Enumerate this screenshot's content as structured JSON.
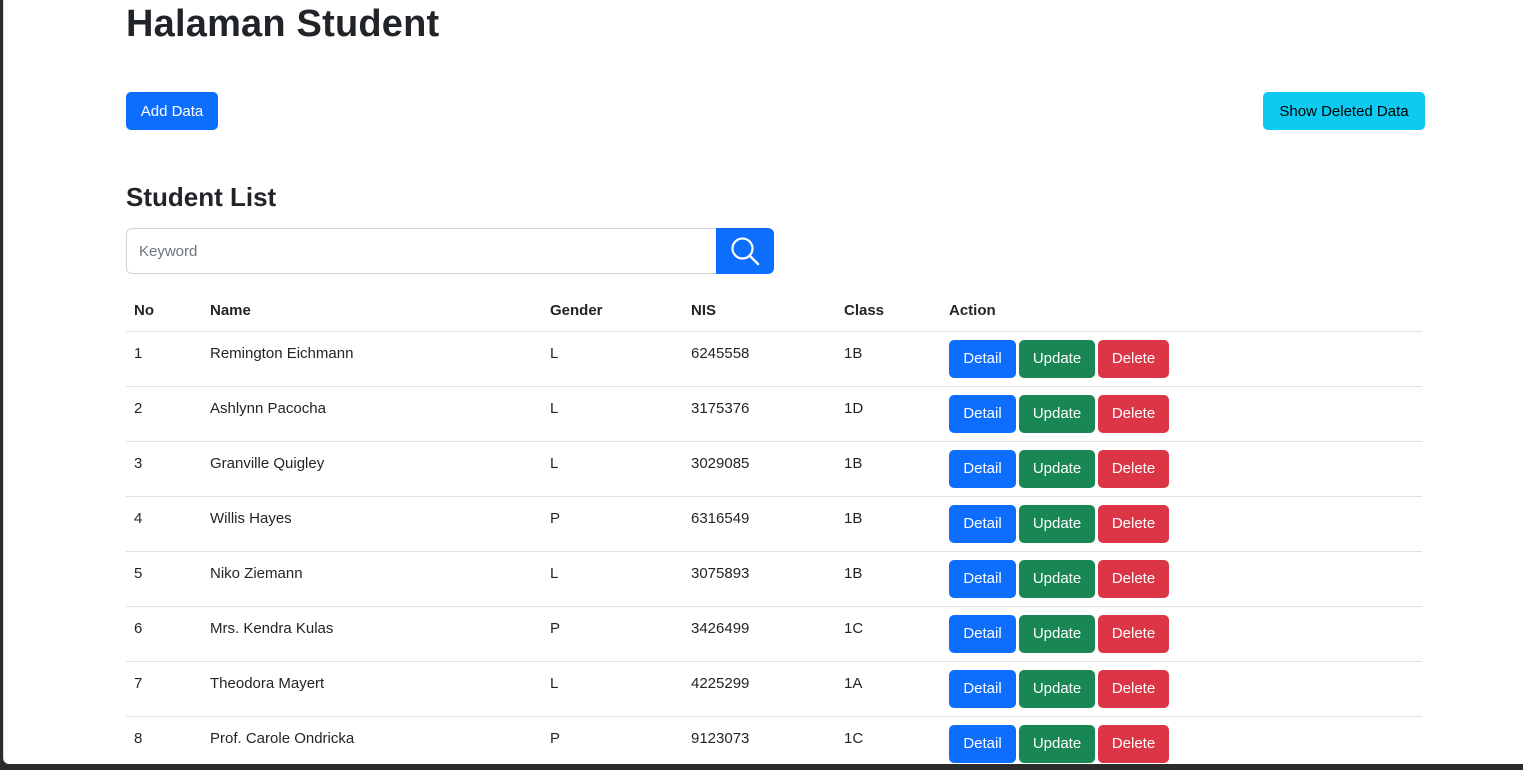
{
  "header": {
    "title": "Halaman Student"
  },
  "toolbar": {
    "add_label": "Add Data",
    "show_deleted_label": "Show Deleted Data"
  },
  "list": {
    "title": "Student List",
    "search": {
      "placeholder": "Keyword",
      "value": "",
      "icon": "search-icon"
    }
  },
  "table": {
    "headers": {
      "no": "No",
      "name": "Name",
      "gender": "Gender",
      "nis": "NIS",
      "class": "Class",
      "action": "Action"
    },
    "actions": {
      "detail": "Detail",
      "update": "Update",
      "delete": "Delete"
    },
    "rows": [
      {
        "no": "1",
        "name": "Remington Eichmann",
        "gender": "L",
        "nis": "6245558",
        "class": "1B"
      },
      {
        "no": "2",
        "name": "Ashlynn Pacocha",
        "gender": "L",
        "nis": "3175376",
        "class": "1D"
      },
      {
        "no": "3",
        "name": "Granville Quigley",
        "gender": "L",
        "nis": "3029085",
        "class": "1B"
      },
      {
        "no": "4",
        "name": "Willis Hayes",
        "gender": "P",
        "nis": "6316549",
        "class": "1B"
      },
      {
        "no": "5",
        "name": "Niko Ziemann",
        "gender": "L",
        "nis": "3075893",
        "class": "1B"
      },
      {
        "no": "6",
        "name": "Mrs. Kendra Kulas",
        "gender": "P",
        "nis": "3426499",
        "class": "1C"
      },
      {
        "no": "7",
        "name": "Theodora Mayert",
        "gender": "L",
        "nis": "4225299",
        "class": "1A"
      },
      {
        "no": "8",
        "name": "Prof. Carole Ondricka",
        "gender": "P",
        "nis": "9123073",
        "class": "1C"
      }
    ]
  },
  "colors": {
    "primary": "#0d6efd",
    "info": "#0dcaf0",
    "success": "#198754",
    "danger": "#dc3545"
  }
}
